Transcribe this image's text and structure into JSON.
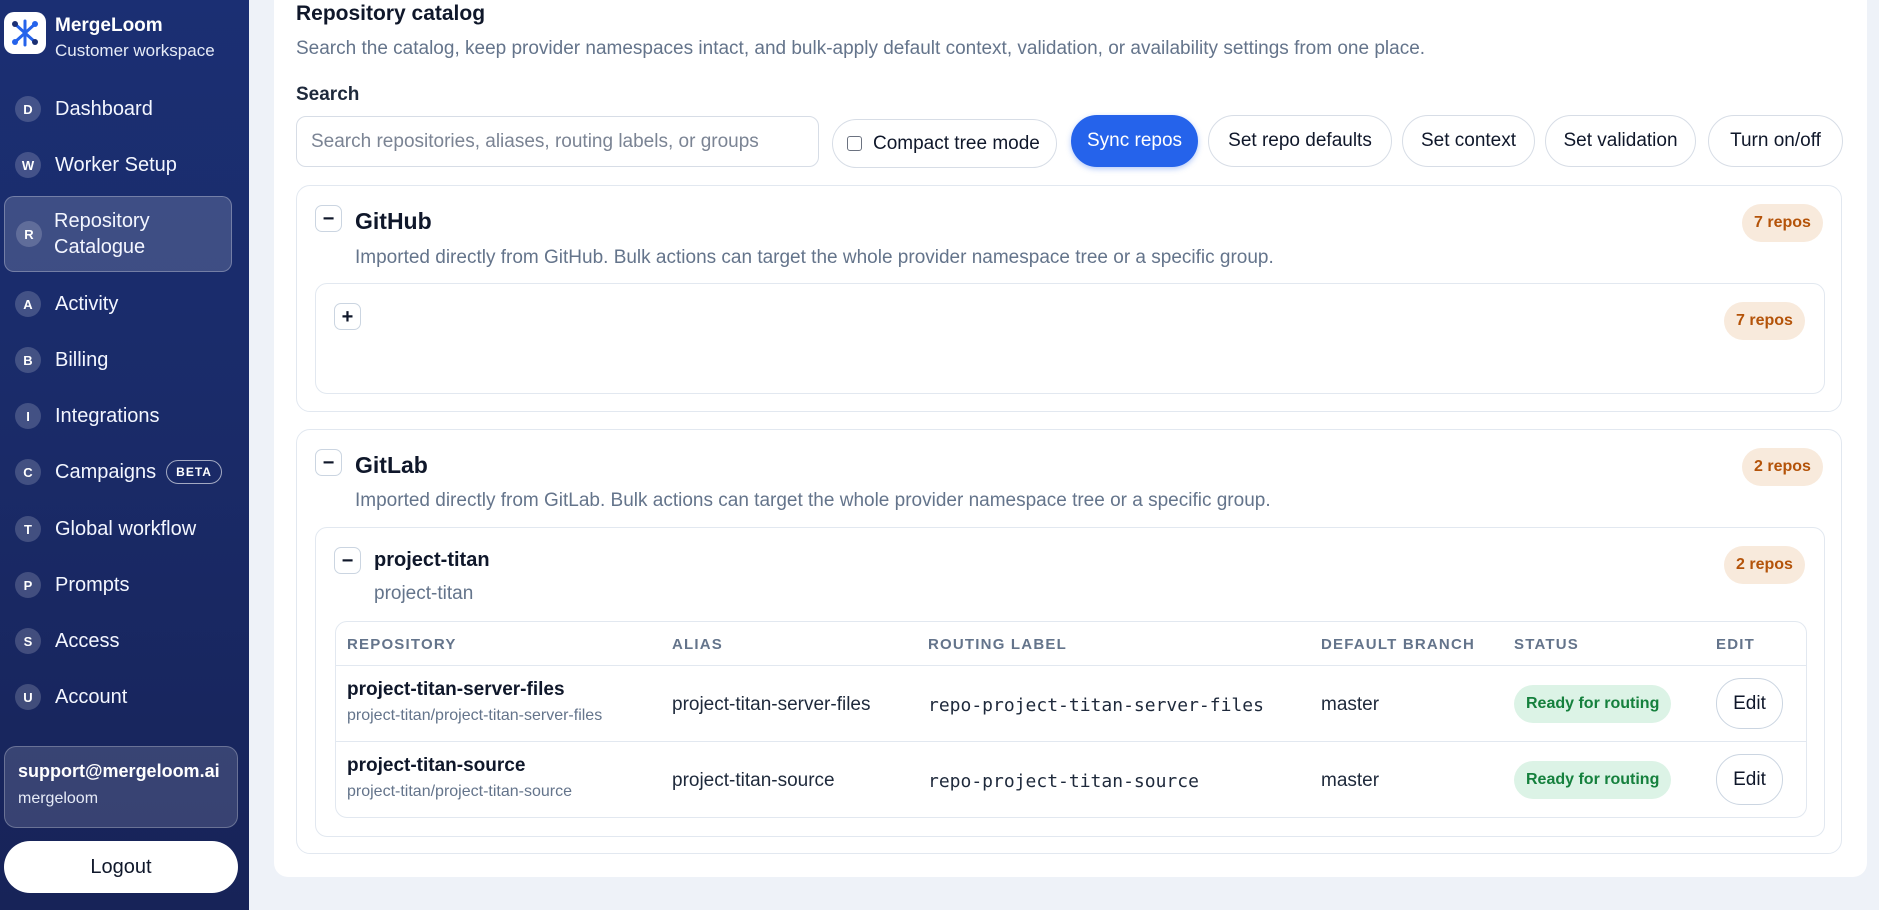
{
  "brand": {
    "name": "MergeLoom",
    "subtitle": "Customer workspace"
  },
  "nav": [
    {
      "letter": "D",
      "label": "Dashboard"
    },
    {
      "letter": "W",
      "label": "Worker Setup"
    },
    {
      "letter": "R",
      "label": "Repository Catalogue",
      "line1": "Repository",
      "line2": "Catalogue",
      "active": true
    },
    {
      "letter": "A",
      "label": "Activity"
    },
    {
      "letter": "B",
      "label": "Billing"
    },
    {
      "letter": "I",
      "label": "Integrations"
    },
    {
      "letter": "C",
      "label": "Campaigns",
      "badge": "BETA"
    },
    {
      "letter": "T",
      "label": "Global workflow"
    },
    {
      "letter": "P",
      "label": "Prompts"
    },
    {
      "letter": "S",
      "label": "Access"
    },
    {
      "letter": "U",
      "label": "Account"
    }
  ],
  "user": {
    "email": "support@mergeloom.ai",
    "org": "mergeloom"
  },
  "logout_label": "Logout",
  "page": {
    "title": "Repository catalog",
    "description": "Search the catalog, keep provider namespaces intact, and bulk-apply default context, validation, or availability settings from one place.",
    "search_label": "Search",
    "search_placeholder": "Search repositories, aliases, routing labels, or groups",
    "search_value": "",
    "compact_label": "Compact tree mode",
    "compact_checked": false
  },
  "actions": {
    "sync": "Sync repos",
    "defaults": "Set repo defaults",
    "context": "Set context",
    "validation": "Set validation",
    "toggle": "Turn on/off"
  },
  "providers": [
    {
      "name": "GitHub",
      "description": "Imported directly from GitHub. Bulk actions can target the whole provider namespace tree or a specific group.",
      "count": "7 repos",
      "collapse_symbol": "−",
      "groups": [
        {
          "name": "",
          "count": "7 repos",
          "expand_symbol": "+"
        }
      ]
    },
    {
      "name": "GitLab",
      "description": "Imported directly from GitLab. Bulk actions can target the whole provider namespace tree or a specific group.",
      "count": "2 repos",
      "collapse_symbol": "−",
      "groups": [
        {
          "name": "project-titan",
          "path": "project-titan",
          "count": "2 repos",
          "collapse_symbol": "−",
          "columns": [
            "REPOSITORY",
            "ALIAS",
            "ROUTING LABEL",
            "DEFAULT BRANCH",
            "STATUS",
            "EDIT"
          ],
          "rows": [
            {
              "name": "project-titan-server-files",
              "path": "project-titan/project-titan-server-files",
              "alias": "project-titan-server-files",
              "routing_label": "repo-project-titan-server-files",
              "branch": "master",
              "status": "Ready for routing",
              "edit": "Edit"
            },
            {
              "name": "project-titan-source",
              "path": "project-titan/project-titan-source",
              "alias": "project-titan-source",
              "routing_label": "repo-project-titan-source",
              "branch": "master",
              "status": "Ready for routing",
              "edit": "Edit"
            }
          ]
        }
      ]
    }
  ],
  "colors": {
    "sidebar": "#1b2f73",
    "primary": "#2563eb",
    "count_pill_bg": "#f8eadc",
    "count_pill_text": "#b45309",
    "status_bg": "#dcf3e6",
    "status_text": "#15803d"
  }
}
